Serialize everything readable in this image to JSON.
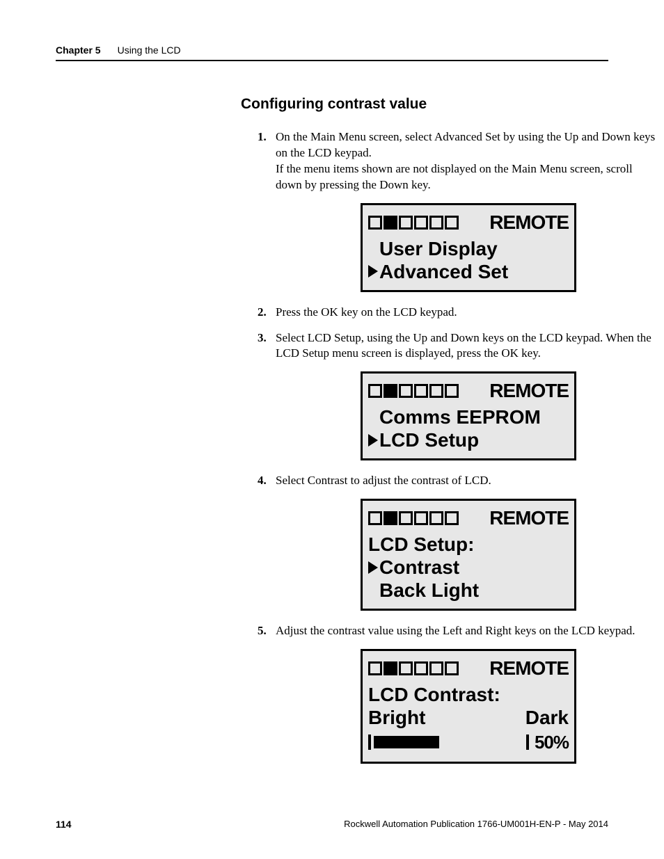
{
  "header": {
    "chapter_label": "Chapter 5",
    "chapter_title": "Using the LCD"
  },
  "section_title": "Configuring contrast value",
  "steps": [
    {
      "text": "On the Main Menu screen, select Advanced Set by using the Up and Down keys on the LCD keypad.",
      "extra": "If the menu items shown are not displayed on the Main Menu screen, scroll down by pressing the Down key.",
      "lcd": {
        "filled_box_index": 1,
        "remote": "REMOTE",
        "rows": [
          {
            "text": "User Display",
            "selected": false
          },
          {
            "text": "Advanced Set",
            "selected": true
          }
        ]
      }
    },
    {
      "text": "Press the OK key on the LCD keypad."
    },
    {
      "text": "Select LCD Setup, using the Up and Down keys on the LCD keypad. When the LCD Setup menu screen is displayed, press the OK key.",
      "lcd": {
        "filled_box_index": 1,
        "remote": "REMOTE",
        "rows": [
          {
            "text": "Comms EEPROM",
            "selected": false
          },
          {
            "text": "LCD Setup",
            "selected": true
          }
        ]
      }
    },
    {
      "text": "Select Contrast to adjust the contrast of LCD.",
      "lcd": {
        "filled_box_index": 1,
        "remote": "REMOTE",
        "rows": [
          {
            "text": "LCD Setup:",
            "selected": false,
            "no_indent": true
          },
          {
            "text": "Contrast",
            "selected": true
          },
          {
            "text": "Back Light",
            "selected": false
          }
        ]
      }
    },
    {
      "text": "Adjust the contrast value using the Left and Right keys on the LCD keypad.",
      "lcd": {
        "filled_box_index": 1,
        "remote": "REMOTE",
        "rows": [
          {
            "text": "LCD Contrast:",
            "selected": false,
            "no_indent": true
          }
        ],
        "contrast": {
          "left_label": "Bright",
          "right_label": "Dark",
          "percent_label": "50%",
          "fill_fraction": 0.42
        }
      }
    }
  ],
  "footer": {
    "page_number": "114",
    "publication": "Rockwell Automation Publication 1766-UM001H-EN-P - May 2014"
  }
}
